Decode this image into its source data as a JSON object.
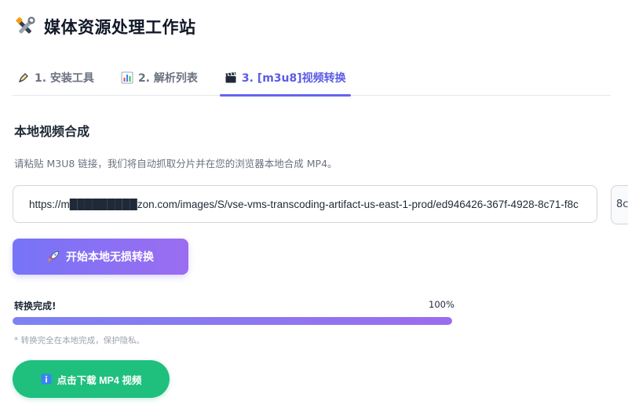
{
  "app": {
    "title": "媒体资源处理工作站",
    "icon": "tools-icon"
  },
  "tabs": [
    {
      "label": "1. 安装工具",
      "icon": "pen-tool-icon",
      "active": false
    },
    {
      "label": "2. 解析列表",
      "icon": "bar-chart-icon",
      "active": false
    },
    {
      "label": "3. [m3u8]视频转换",
      "icon": "clapperboard-icon",
      "active": true
    }
  ],
  "section": {
    "title": "本地视频合成",
    "description": "请粘贴 M3U8 链接，我们将自动抓取分片并在您的浏览器本地合成 MP4。"
  },
  "url_input": {
    "value": "https://m█████████zon.com/images/S/vse-vms-transcoding-artifact-us-east-1-prod/ed946426-367f-4928-8c71-f8c",
    "side_chip_text": "8c"
  },
  "start_button": {
    "label": "开始本地无损转换",
    "icon": "rocket-icon"
  },
  "progress": {
    "label": "转换完成!",
    "percent_text": "100%",
    "value": 1.0
  },
  "note": "* 转换完全在本地完成，保护隐私。",
  "download_button": {
    "label": "点击下载 MP4 视频",
    "icon": "info-icon"
  },
  "colors": {
    "accent": "#6366f1",
    "primary_gradient_start": "#7774f7",
    "primary_gradient_end": "#9b6df0",
    "success": "#1fbf7d"
  }
}
